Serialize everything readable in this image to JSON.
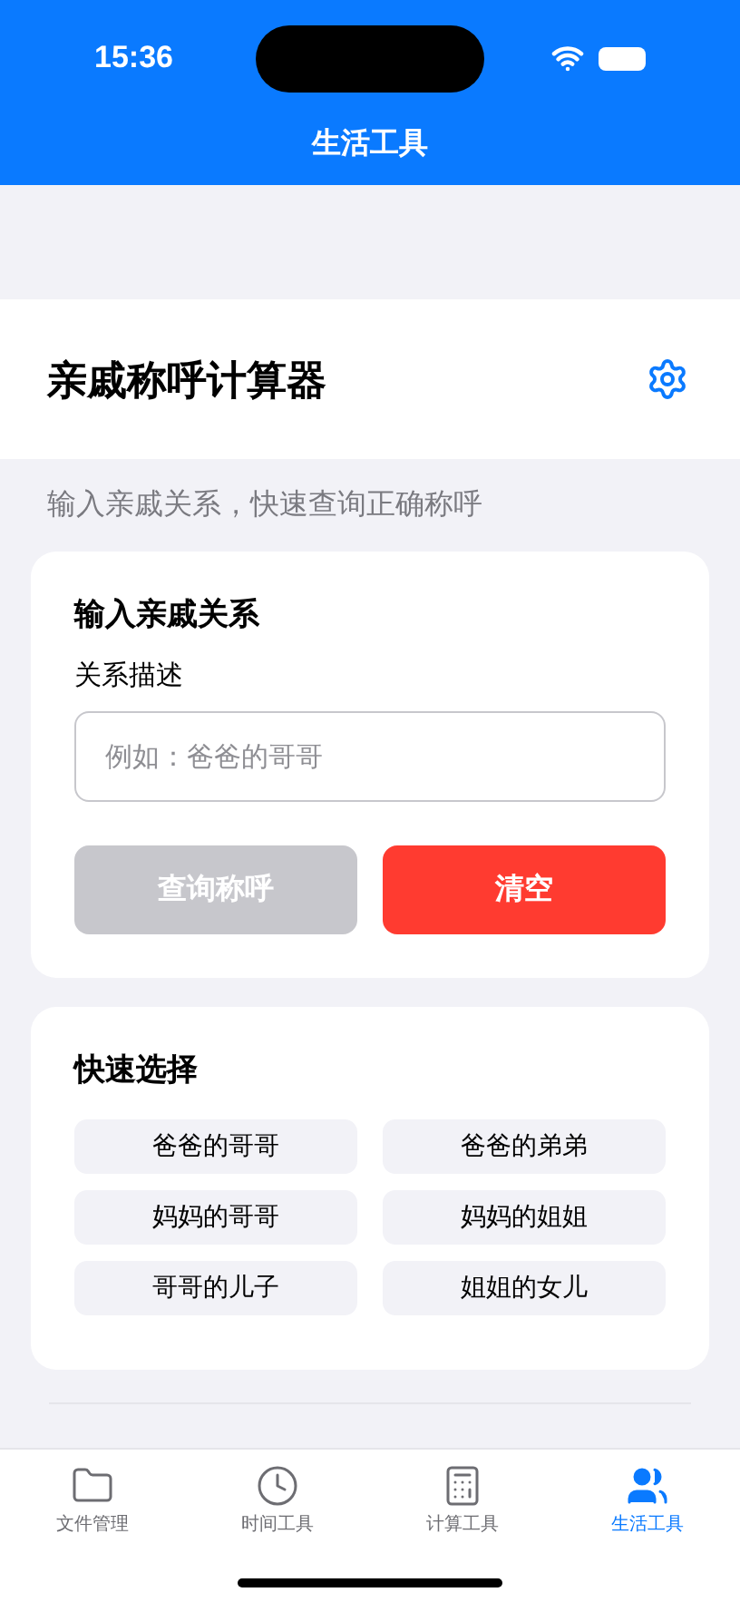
{
  "status_bar": {
    "time": "15:36"
  },
  "nav": {
    "title": "生活工具"
  },
  "header": {
    "title": "亲戚称呼计算器"
  },
  "subtitle": "输入亲戚关系，快速查询正确称呼",
  "input_card": {
    "title": "输入亲戚关系",
    "field_label": "关系描述",
    "placeholder": "例如：爸爸的哥哥",
    "buttons": [
      {
        "label": "查询称呼",
        "kind": "query",
        "disabled": true
      },
      {
        "label": "清空",
        "kind": "clear",
        "disabled": false
      }
    ]
  },
  "quick_select": {
    "title": "快速选择",
    "items": [
      "爸爸的哥哥",
      "爸爸的弟弟",
      "妈妈的哥哥",
      "妈妈的姐姐",
      "哥哥的儿子",
      "姐姐的女儿"
    ]
  },
  "tab_bar": [
    {
      "label": "文件管理",
      "kind": "folder",
      "selected": false
    },
    {
      "label": "时间工具",
      "kind": "clock",
      "selected": false
    },
    {
      "label": "计算工具",
      "kind": "calculator",
      "selected": false
    },
    {
      "label": "生活工具",
      "kind": "people",
      "selected": true
    }
  ]
}
